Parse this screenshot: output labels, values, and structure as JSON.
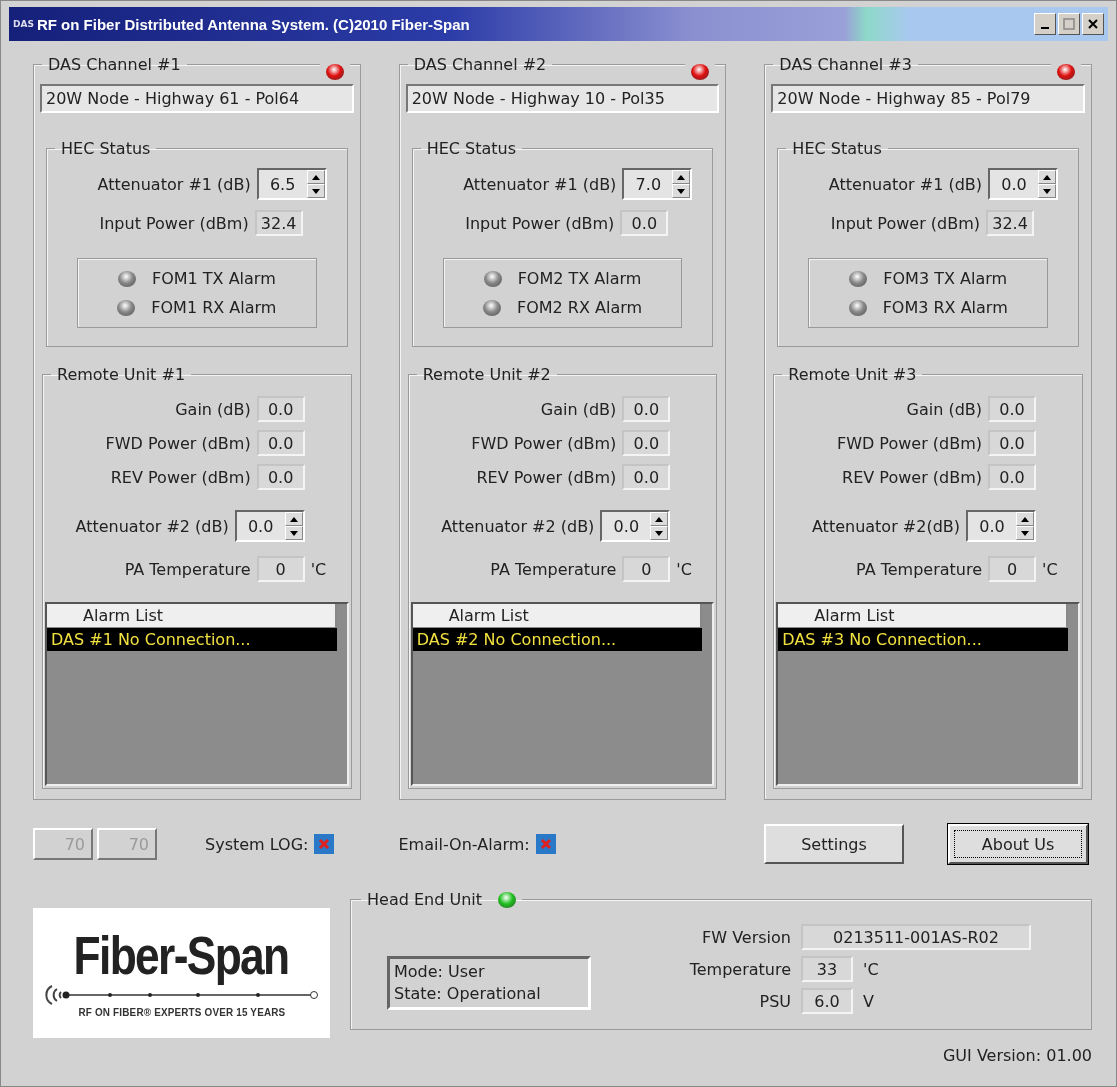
{
  "window": {
    "icon_label": "DAS",
    "title": "RF on Fiber Distributed Antenna System. (C)2010 Fiber-Span"
  },
  "channels": [
    {
      "title": "DAS Channel #1",
      "alarm": true,
      "name": "20W Node - Highway 61 - Pol64",
      "hec": {
        "title": "HEC Status",
        "attenuator": {
          "label": "Attenuator #1 (dB)",
          "value": "6.5"
        },
        "input_power": {
          "label": "Input Power (dBm)",
          "value": "32.4"
        },
        "alarms": [
          {
            "label": "FOM1 TX Alarm",
            "active": false
          },
          {
            "label": "FOM1 RX Alarm",
            "active": false
          }
        ]
      },
      "remote": {
        "title": "Remote Unit #1",
        "fields": [
          {
            "kind": "readout",
            "label": "Gain (dB)",
            "value": "0.0"
          },
          {
            "kind": "readout",
            "label": "FWD Power (dBm)",
            "value": "0.0"
          },
          {
            "kind": "readout",
            "label": "REV Power (dBm)",
            "value": "0.0"
          },
          {
            "kind": "spin",
            "label": "Attenuator #2 (dB)",
            "value": "0.0"
          },
          {
            "kind": "readout",
            "label": "PA Temperature",
            "value": "0",
            "unit": "'C"
          }
        ]
      },
      "alarm_list": {
        "header": "Alarm List",
        "rows": [
          {
            "text": "DAS #1 No Connection...",
            "selected": true
          }
        ]
      }
    },
    {
      "title": "DAS Channel #2",
      "alarm": true,
      "name": "20W Node - Highway 10 - Pol35",
      "hec": {
        "title": "HEC Status",
        "attenuator": {
          "label": "Attenuator #1 (dB)",
          "value": "7.0"
        },
        "input_power": {
          "label": "Input Power (dBm)",
          "value": "0.0"
        },
        "alarms": [
          {
            "label": "FOM2 TX Alarm",
            "active": false
          },
          {
            "label": "FOM2 RX Alarm",
            "active": false
          }
        ]
      },
      "remote": {
        "title": "Remote Unit #2",
        "fields": [
          {
            "kind": "readout",
            "label": "Gain (dB)",
            "value": "0.0"
          },
          {
            "kind": "readout",
            "label": "FWD Power (dBm)",
            "value": "0.0"
          },
          {
            "kind": "readout",
            "label": "REV Power (dBm)",
            "value": "0.0"
          },
          {
            "kind": "spin",
            "label": "Attenuator #2 (dB)",
            "value": "0.0"
          },
          {
            "kind": "readout",
            "label": "PA Temperature",
            "value": "0",
            "unit": "'C"
          }
        ]
      },
      "alarm_list": {
        "header": "Alarm List",
        "rows": [
          {
            "text": "DAS #2 No Connection...",
            "selected": true
          }
        ]
      }
    },
    {
      "title": "DAS Channel #3",
      "alarm": true,
      "name": "20W Node - Highway 85 - Pol79",
      "hec": {
        "title": "HEC Status",
        "attenuator": {
          "label": "Attenuator #1 (dB)",
          "value": "0.0"
        },
        "input_power": {
          "label": "Input Power (dBm)",
          "value": "32.4"
        },
        "alarms": [
          {
            "label": "FOM3 TX Alarm",
            "active": false
          },
          {
            "label": "FOM3 RX Alarm",
            "active": false
          }
        ]
      },
      "remote": {
        "title": "Remote Unit #3",
        "fields": [
          {
            "kind": "readout",
            "label": "Gain (dB)",
            "value": "0.0"
          },
          {
            "kind": "readout",
            "label": "FWD Power (dBm)",
            "value": "0.0"
          },
          {
            "kind": "readout",
            "label": "REV Power (dBm)",
            "value": "0.0"
          },
          {
            "kind": "spin",
            "label": "Attenuator #2(dB)",
            "value": "0.0"
          },
          {
            "kind": "readout",
            "label": "PA Temperature",
            "value": "0",
            "unit": "'C"
          }
        ]
      },
      "alarm_list": {
        "header": "Alarm List",
        "rows": [
          {
            "text": "DAS #3 No Connection...",
            "selected": true
          }
        ]
      }
    }
  ],
  "controls": {
    "counters": [
      {
        "value": "70",
        "disabled": true
      },
      {
        "value": "70",
        "disabled": true
      }
    ],
    "toggles": [
      {
        "label": "System LOG:",
        "checked": true
      },
      {
        "label": "Email-On-Alarm:",
        "checked": true
      }
    ],
    "buttons": [
      {
        "label": "Settings",
        "focused": false
      },
      {
        "label": "About Us",
        "focused": true
      }
    ]
  },
  "logo": {
    "wordmark": "Fiber-Span",
    "tagline": "RF ON FIBER® EXPERTS OVER 15 YEARS"
  },
  "head_end": {
    "title": "Head End Unit",
    "online": true,
    "status_lines": [
      "Mode: User",
      "State: Operational"
    ],
    "fields": [
      {
        "label": "FW Version",
        "value": "0213511-001AS-R02",
        "kind": "wide"
      },
      {
        "label": "Temperature",
        "value": "33",
        "unit": "'C",
        "kind": "short"
      },
      {
        "label": "PSU",
        "value": "6.0",
        "unit": "V",
        "kind": "short"
      }
    ]
  },
  "gui_version": "GUI Version: 01.00"
}
